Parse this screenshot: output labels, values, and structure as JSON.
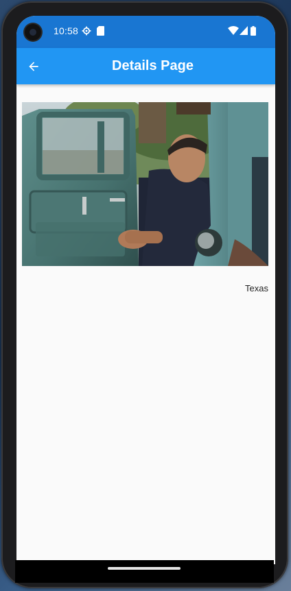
{
  "status_bar": {
    "time": "10:58",
    "left_icons": [
      "settings-icon",
      "sd-card-icon"
    ],
    "right_icons": [
      "wifi-icon",
      "signal-icon",
      "battery-icon"
    ],
    "color": "#1976d2"
  },
  "app_bar": {
    "title": "Details Page",
    "back_icon": "arrow-back-icon",
    "color": "#2196f3"
  },
  "content": {
    "image_alt": "Man sitting in the open door of an old green truck",
    "caption": "Texas"
  }
}
